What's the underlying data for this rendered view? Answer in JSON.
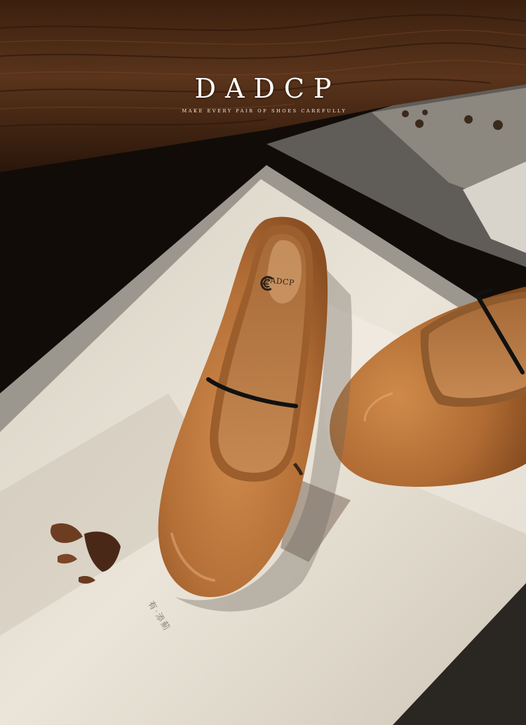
{
  "brand": {
    "name": "DADCP",
    "tagline": "MAKE EVERY PAIR OF SHOES CAREFULLY"
  },
  "insole": {
    "logo_text": "DADCP"
  },
  "book": {
    "print_text": "有·添薊"
  },
  "colors": {
    "wood": "#4a2a17",
    "leather": "#b8753e",
    "paper": "#e6dfd2",
    "strap": "#111111"
  }
}
